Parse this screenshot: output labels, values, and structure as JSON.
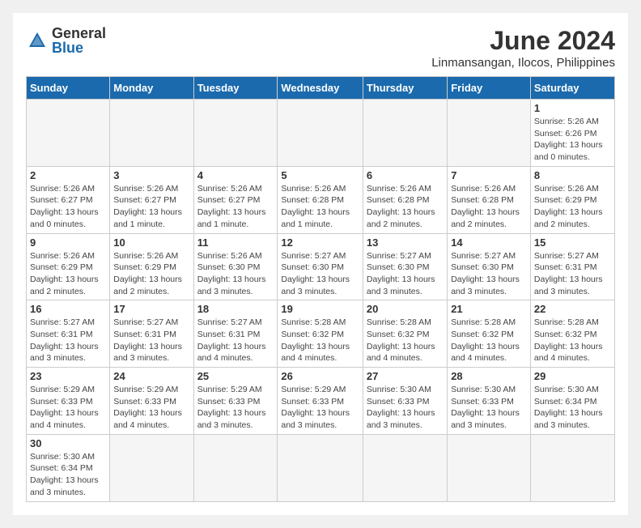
{
  "logo": {
    "general": "General",
    "blue": "Blue"
  },
  "header": {
    "month_year": "June 2024",
    "location": "Linmansangan, Ilocos, Philippines"
  },
  "weekdays": [
    "Sunday",
    "Monday",
    "Tuesday",
    "Wednesday",
    "Thursday",
    "Friday",
    "Saturday"
  ],
  "weeks": [
    [
      {
        "day": "",
        "info": ""
      },
      {
        "day": "",
        "info": ""
      },
      {
        "day": "",
        "info": ""
      },
      {
        "day": "",
        "info": ""
      },
      {
        "day": "",
        "info": ""
      },
      {
        "day": "",
        "info": ""
      },
      {
        "day": "1",
        "info": "Sunrise: 5:26 AM\nSunset: 6:26 PM\nDaylight: 13 hours\nand 0 minutes."
      }
    ],
    [
      {
        "day": "2",
        "info": "Sunrise: 5:26 AM\nSunset: 6:27 PM\nDaylight: 13 hours\nand 0 minutes."
      },
      {
        "day": "3",
        "info": "Sunrise: 5:26 AM\nSunset: 6:27 PM\nDaylight: 13 hours\nand 1 minute."
      },
      {
        "day": "4",
        "info": "Sunrise: 5:26 AM\nSunset: 6:27 PM\nDaylight: 13 hours\nand 1 minute."
      },
      {
        "day": "5",
        "info": "Sunrise: 5:26 AM\nSunset: 6:28 PM\nDaylight: 13 hours\nand 1 minute."
      },
      {
        "day": "6",
        "info": "Sunrise: 5:26 AM\nSunset: 6:28 PM\nDaylight: 13 hours\nand 2 minutes."
      },
      {
        "day": "7",
        "info": "Sunrise: 5:26 AM\nSunset: 6:28 PM\nDaylight: 13 hours\nand 2 minutes."
      },
      {
        "day": "8",
        "info": "Sunrise: 5:26 AM\nSunset: 6:29 PM\nDaylight: 13 hours\nand 2 minutes."
      }
    ],
    [
      {
        "day": "9",
        "info": "Sunrise: 5:26 AM\nSunset: 6:29 PM\nDaylight: 13 hours\nand 2 minutes."
      },
      {
        "day": "10",
        "info": "Sunrise: 5:26 AM\nSunset: 6:29 PM\nDaylight: 13 hours\nand 2 minutes."
      },
      {
        "day": "11",
        "info": "Sunrise: 5:26 AM\nSunset: 6:30 PM\nDaylight: 13 hours\nand 3 minutes."
      },
      {
        "day": "12",
        "info": "Sunrise: 5:27 AM\nSunset: 6:30 PM\nDaylight: 13 hours\nand 3 minutes."
      },
      {
        "day": "13",
        "info": "Sunrise: 5:27 AM\nSunset: 6:30 PM\nDaylight: 13 hours\nand 3 minutes."
      },
      {
        "day": "14",
        "info": "Sunrise: 5:27 AM\nSunset: 6:30 PM\nDaylight: 13 hours\nand 3 minutes."
      },
      {
        "day": "15",
        "info": "Sunrise: 5:27 AM\nSunset: 6:31 PM\nDaylight: 13 hours\nand 3 minutes."
      }
    ],
    [
      {
        "day": "16",
        "info": "Sunrise: 5:27 AM\nSunset: 6:31 PM\nDaylight: 13 hours\nand 3 minutes."
      },
      {
        "day": "17",
        "info": "Sunrise: 5:27 AM\nSunset: 6:31 PM\nDaylight: 13 hours\nand 3 minutes."
      },
      {
        "day": "18",
        "info": "Sunrise: 5:27 AM\nSunset: 6:31 PM\nDaylight: 13 hours\nand 4 minutes."
      },
      {
        "day": "19",
        "info": "Sunrise: 5:28 AM\nSunset: 6:32 PM\nDaylight: 13 hours\nand 4 minutes."
      },
      {
        "day": "20",
        "info": "Sunrise: 5:28 AM\nSunset: 6:32 PM\nDaylight: 13 hours\nand 4 minutes."
      },
      {
        "day": "21",
        "info": "Sunrise: 5:28 AM\nSunset: 6:32 PM\nDaylight: 13 hours\nand 4 minutes."
      },
      {
        "day": "22",
        "info": "Sunrise: 5:28 AM\nSunset: 6:32 PM\nDaylight: 13 hours\nand 4 minutes."
      }
    ],
    [
      {
        "day": "23",
        "info": "Sunrise: 5:29 AM\nSunset: 6:33 PM\nDaylight: 13 hours\nand 4 minutes."
      },
      {
        "day": "24",
        "info": "Sunrise: 5:29 AM\nSunset: 6:33 PM\nDaylight: 13 hours\nand 4 minutes."
      },
      {
        "day": "25",
        "info": "Sunrise: 5:29 AM\nSunset: 6:33 PM\nDaylight: 13 hours\nand 3 minutes."
      },
      {
        "day": "26",
        "info": "Sunrise: 5:29 AM\nSunset: 6:33 PM\nDaylight: 13 hours\nand 3 minutes."
      },
      {
        "day": "27",
        "info": "Sunrise: 5:30 AM\nSunset: 6:33 PM\nDaylight: 13 hours\nand 3 minutes."
      },
      {
        "day": "28",
        "info": "Sunrise: 5:30 AM\nSunset: 6:33 PM\nDaylight: 13 hours\nand 3 minutes."
      },
      {
        "day": "29",
        "info": "Sunrise: 5:30 AM\nSunset: 6:34 PM\nDaylight: 13 hours\nand 3 minutes."
      }
    ],
    [
      {
        "day": "30",
        "info": "Sunrise: 5:30 AM\nSunset: 6:34 PM\nDaylight: 13 hours\nand 3 minutes."
      },
      {
        "day": "",
        "info": ""
      },
      {
        "day": "",
        "info": ""
      },
      {
        "day": "",
        "info": ""
      },
      {
        "day": "",
        "info": ""
      },
      {
        "day": "",
        "info": ""
      },
      {
        "day": "",
        "info": ""
      }
    ]
  ]
}
